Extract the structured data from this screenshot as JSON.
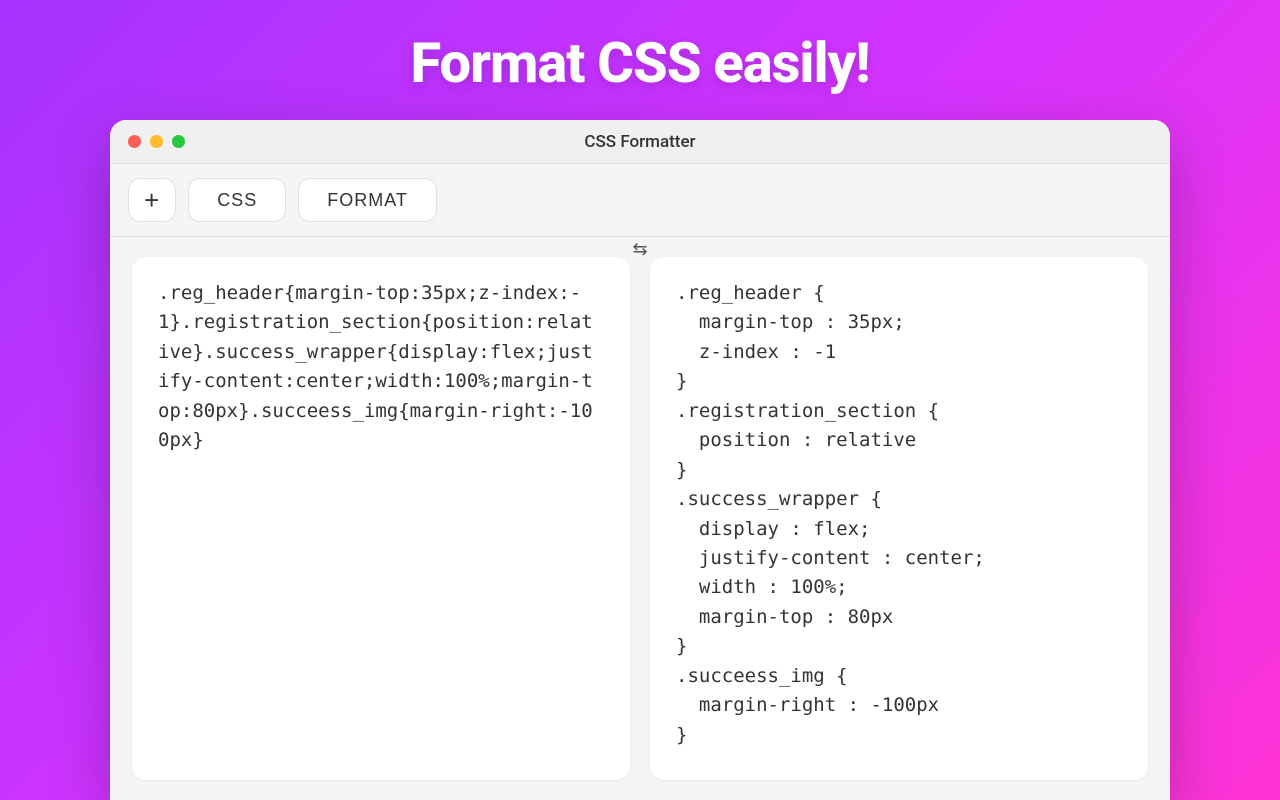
{
  "hero": {
    "title": "Format CSS easily!"
  },
  "window": {
    "title": "CSS Formatter",
    "traffic_lights": {
      "red": "#ff5f57",
      "yellow": "#febc2e",
      "green": "#28c840"
    }
  },
  "toolbar": {
    "add_label": "+",
    "css_label": "CSS",
    "format_label": "FORMAT"
  },
  "swap_icon": "⇆",
  "panels": {
    "input_code": ".reg_header{margin-top:35px;z-index:-1}.registration_section{position:relative}.success_wrapper{display:flex;justify-content:center;width:100%;margin-top:80px}.succeess_img{margin-right:-100px}",
    "output_code": ".reg_header {\n  margin-top : 35px;\n  z-index : -1\n}\n.registration_section {\n  position : relative\n}\n.success_wrapper {\n  display : flex;\n  justify-content : center;\n  width : 100%;\n  margin-top : 80px\n}\n.succeess_img {\n  margin-right : -100px\n}"
  }
}
